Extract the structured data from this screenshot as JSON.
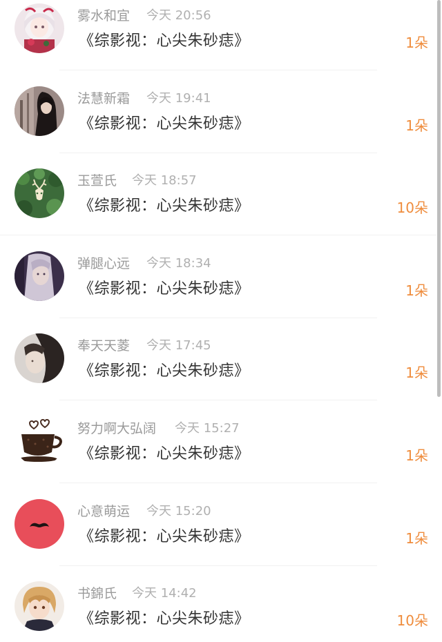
{
  "items": [
    {
      "name": "雾水和宜",
      "time": "今天 20:56",
      "title": "《综影视：心尖朱砂痣》",
      "amount": "1朵",
      "avatar": "anime-girl-white-hair-avatar"
    },
    {
      "name": "法慧新霜",
      "time": "今天 19:41",
      "title": "《综影视：心尖朱砂痣》",
      "amount": "1朵",
      "avatar": "dark-hair-character-avatar"
    },
    {
      "name": "玉萱氏",
      "time": "今天 18:57",
      "title": "《综影视：心尖朱砂痣》",
      "amount": "10朵",
      "avatar": "deer-on-leaves-avatar"
    },
    {
      "name": "弹腿心远",
      "time": "今天 18:34",
      "title": "《综影视：心尖朱砂痣》",
      "amount": "1朵",
      "avatar": "silver-hair-girl-avatar"
    },
    {
      "name": "奉天天菱",
      "time": "今天 17:45",
      "title": "《综影视：心尖朱砂痣》",
      "amount": "1朵",
      "avatar": "portrait-photo-avatar"
    },
    {
      "name": "努力啊大弘阔",
      "time": "今天 15:27",
      "title": "《综影视：心尖朱砂痣》",
      "amount": "1朵",
      "avatar": "coffee-cup-hearts-avatar"
    },
    {
      "name": "心意萌运",
      "time": "今天 15:20",
      "title": "《综影视：心尖朱砂痣》",
      "amount": "1朵",
      "avatar": "mustache-red-avatar"
    },
    {
      "name": "书錦氏",
      "time": "今天 14:42",
      "title": "《综影视：心尖朱砂痣》",
      "amount": "10朵",
      "avatar": "anime-boy-avatar"
    }
  ],
  "colors": {
    "name": "#9a9a9a",
    "time": "#b0b0b0",
    "title": "#333333",
    "amount": "#ef8c3c"
  }
}
